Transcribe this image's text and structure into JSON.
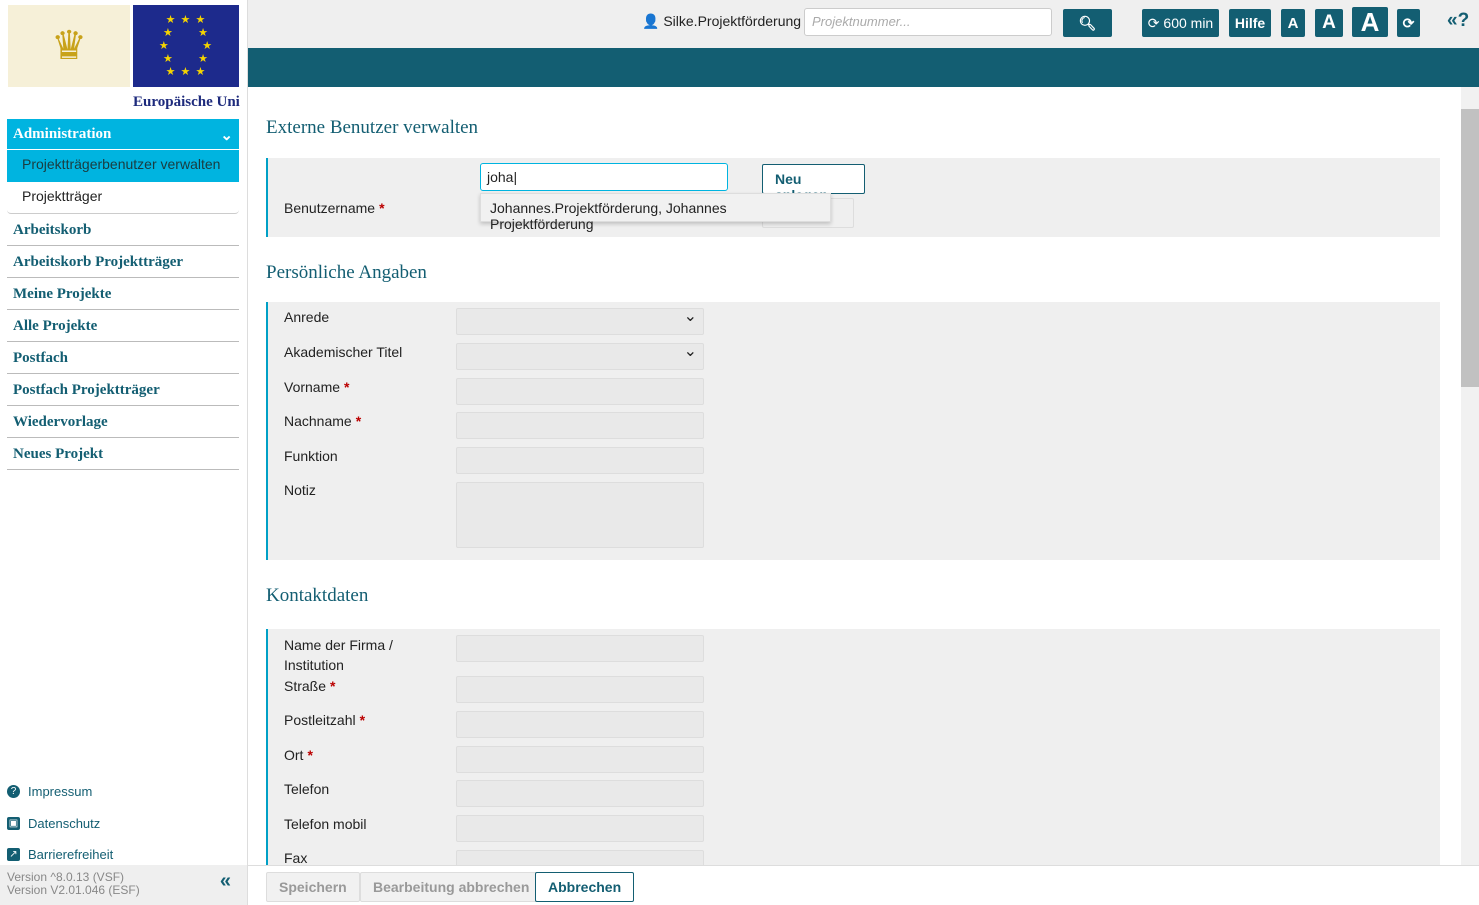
{
  "sidebar": {
    "eu_text": "Europäische Uni",
    "admin": "Administration",
    "sub_items": [
      "Projektträgerbenutzer verwalten",
      "Projektträger"
    ],
    "items": [
      "Arbeitskorb",
      "Arbeitskorb Projektträger",
      "Meine Projekte",
      "Alle Projekte",
      "Postfach",
      "Postfach Projektträger",
      "Wiedervorlage",
      "Neues Projekt"
    ],
    "links": [
      "Impressum",
      "Datenschutz",
      "Barrierefreiheit"
    ],
    "version1": "Version ^8.0.13 (VSF)",
    "version2": "Version V2.01.046 (ESF)"
  },
  "topbar": {
    "user": "Silke.Projektförderung",
    "search_placeholder": "Projektnummer...",
    "timer": "600 min",
    "help": "Hilfe",
    "font_a": "A"
  },
  "page": {
    "title": "Externe Benutzer verwalten",
    "username_label": "Benutzername",
    "username_value": "joha",
    "new_button": "Neu anlegen",
    "suggestion": "Johannes.Projektförderung, Johannes Projektförderung",
    "personal_title": "Persönliche Angaben",
    "personal_fields": [
      "Anrede",
      "Akademischer Titel",
      "Vorname",
      "Nachname",
      "Funktion",
      "Notiz"
    ],
    "contact_title": "Kontaktdaten",
    "contact_fields": [
      "Name der Firma / Institution",
      "Straße",
      "Postleitzahl",
      "Ort",
      "Telefon",
      "Telefon mobil",
      "Fax"
    ]
  },
  "footer": {
    "save": "Speichern",
    "cancel_edit": "Bearbeitung abbrechen",
    "cancel": "Abbrechen"
  },
  "colors": {
    "primary": "#135e72",
    "accent": "#00b4e0"
  }
}
